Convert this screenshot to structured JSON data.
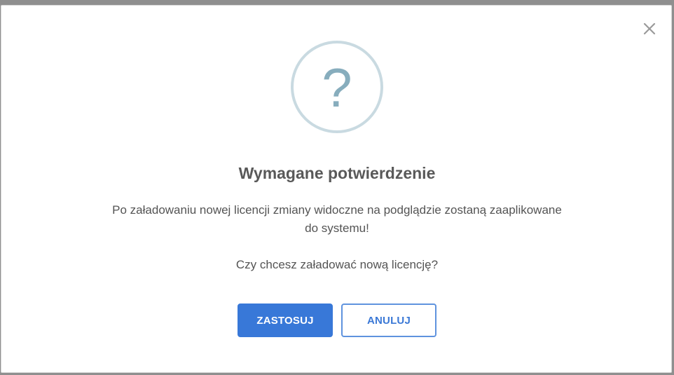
{
  "dialog": {
    "title": "Wymagane potwierdzenie",
    "icon": "question-mark-icon",
    "icon_glyph": "?",
    "message_line1": "Po załadowaniu nowej licencji zmiany widoczne na podglądzie zostaną zaaplikowane",
    "message_line2": "do systemu!",
    "question": "Czy chcesz załadować nową licencję?",
    "confirm_label": "ZASTOSUJ",
    "cancel_label": "ANULUJ",
    "close_icon": "close-icon"
  },
  "colors": {
    "primary": "#3878d8",
    "icon_ring": "#c9dae1",
    "icon_glyph": "#87adbd",
    "title_text": "#595959",
    "body_text": "#545454"
  }
}
